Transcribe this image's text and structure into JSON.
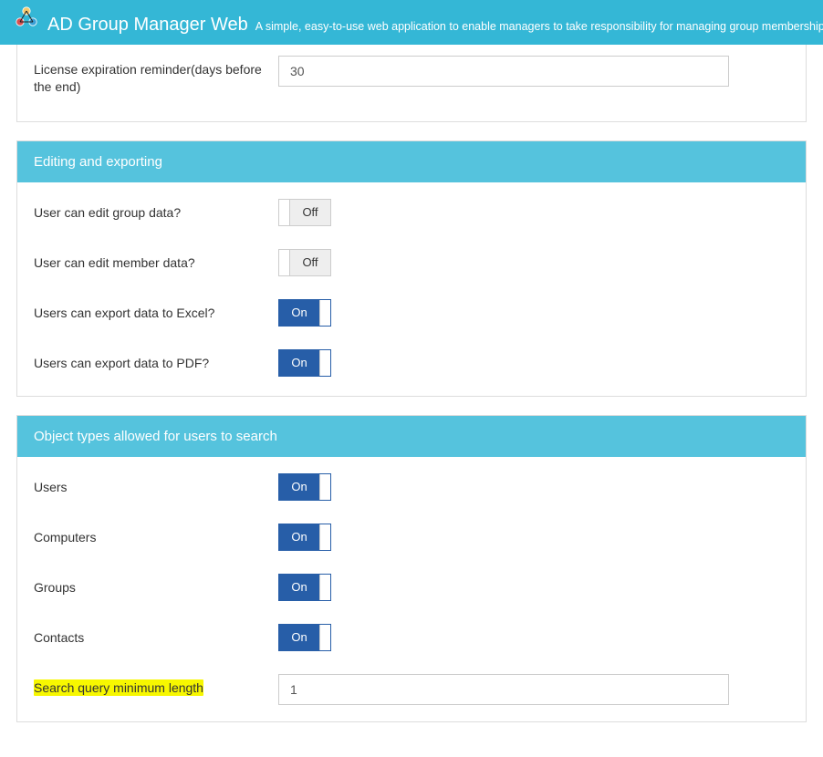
{
  "header": {
    "title": "AD Group Manager Web",
    "subtitle": "A simple, easy-to-use web application to enable managers to take responsibility for managing group membership in Act"
  },
  "panels": {
    "license": {
      "rows": {
        "expiration": {
          "label": "License expiration reminder(days before the end)",
          "value": "30"
        }
      }
    },
    "editing": {
      "title": "Editing and exporting",
      "rows": {
        "editGroup": {
          "label": "User can edit group data?",
          "state": "Off"
        },
        "editMember": {
          "label": "User can edit member data?",
          "state": "Off"
        },
        "exportExcel": {
          "label": "Users can export data to Excel?",
          "state": "On"
        },
        "exportPdf": {
          "label": "Users can export data to PDF?",
          "state": "On"
        }
      }
    },
    "search": {
      "title": "Object types allowed for users to search",
      "rows": {
        "users": {
          "label": "Users",
          "state": "On"
        },
        "computers": {
          "label": "Computers",
          "state": "On"
        },
        "groups": {
          "label": "Groups",
          "state": "On"
        },
        "contacts": {
          "label": "Contacts",
          "state": "On"
        },
        "minlen": {
          "label": "Search query minimum length",
          "value": "1"
        }
      }
    }
  },
  "toggleLabels": {
    "on": "On",
    "off": "Off"
  }
}
